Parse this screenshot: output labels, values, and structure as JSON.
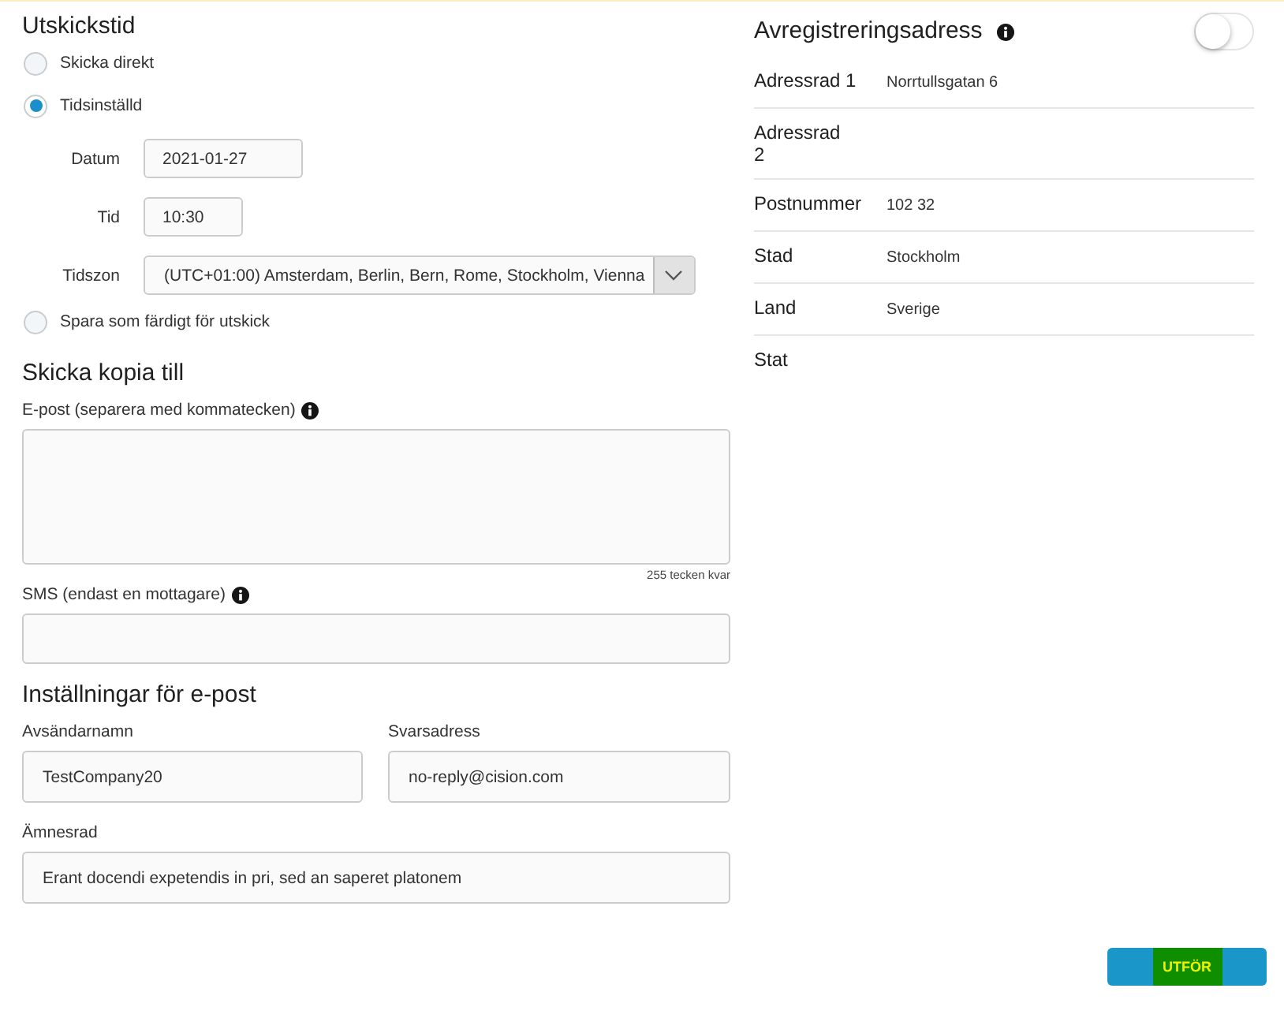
{
  "scheduling": {
    "title": "Utskickstid",
    "options": [
      {
        "label": "Skicka direkt",
        "selected": false
      },
      {
        "label": "Tidsinställd",
        "selected": true,
        "fields": [
          {
            "kind": "date",
            "label": "Datum",
            "value": "2021-01-27"
          },
          {
            "kind": "time",
            "label": "Tid",
            "value": "10:30"
          },
          {
            "kind": "select",
            "label": "Tidszon",
            "value": "(UTC+01:00) Amsterdam, Berlin, Bern, Rome, Stockholm, Vienna"
          }
        ]
      },
      {
        "label": "Spara som färdigt för utskick",
        "selected": false
      }
    ]
  },
  "unsubscribe": {
    "title": "Avregistreringsadress",
    "on": false,
    "rows": [
      {
        "label": "Adressrad 1",
        "value": "Norrtullsgatan 6"
      },
      {
        "label": "Adressrad 2"
      },
      {
        "label": "Postnummer",
        "value": "102 32"
      },
      {
        "label": "Stad",
        "value": "Stockholm"
      },
      {
        "label": "Land",
        "value": "Sverige"
      },
      {
        "label": "Stat"
      }
    ]
  },
  "copy": {
    "title": "Skicka kopia till",
    "email": {
      "label": "E-post (separera med kommatecken)",
      "counter": "255 tecken kvar"
    },
    "sms": {
      "label": "SMS (endast en mottagare)"
    }
  },
  "email_settings": {
    "title": "Inställningar för e-post",
    "fields": [
      {
        "label": "Avsändarnamn",
        "value": "TestCompany20"
      },
      {
        "label": "Svarsadress",
        "value": "no-reply@cision.com"
      },
      {
        "label": "Ämnesrad",
        "value": "Erant docendi expetendis in pri, sed an saperet platonem"
      }
    ]
  },
  "submit_button": "UTFÖR"
}
